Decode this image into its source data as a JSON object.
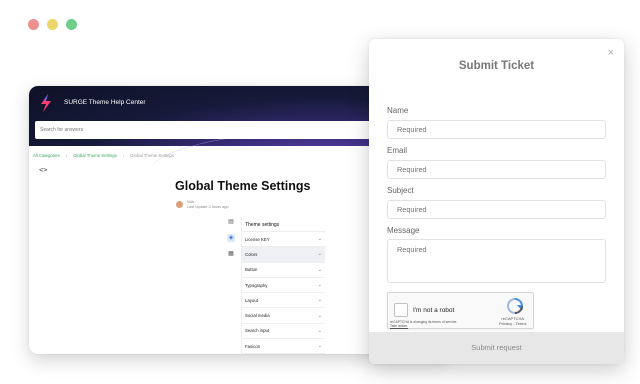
{
  "background_window": {
    "brand": "SURGE Theme Help Center",
    "search_placeholder": "Search for answers",
    "breadcrumb": [
      "All Categories",
      "Global Theme Settings",
      "Global Theme Settings"
    ],
    "code_toggle": "<>",
    "article_title": "Global Theme Settings",
    "author_name": "Nick",
    "author_meta": "Last Update 3 hours ago",
    "settings_panel": {
      "title": "Theme settings",
      "items": [
        "License KEY",
        "Colors",
        "Button",
        "Typography",
        "Layout",
        "Social media",
        "Search input",
        "Favicon"
      ],
      "selected": "Colors"
    }
  },
  "modal": {
    "title": "Submit Ticket",
    "close": "×",
    "fields": [
      {
        "label": "Name",
        "placeholder": "Required"
      },
      {
        "label": "Email",
        "placeholder": "Required"
      },
      {
        "label": "Subject",
        "placeholder": "Required"
      },
      {
        "label": "Message",
        "placeholder": "Required"
      }
    ],
    "recaptcha": {
      "label": "I'm not a robot",
      "brand": "reCAPTCHA",
      "links": "Privacy - Terms",
      "notice": "reCAPTCHA is changing its terms of service.",
      "notice_link": "Take action."
    },
    "submit": "Submit request"
  },
  "colors": {
    "accent_green": "#3aa65a",
    "hero_dark": "#161a3a"
  }
}
